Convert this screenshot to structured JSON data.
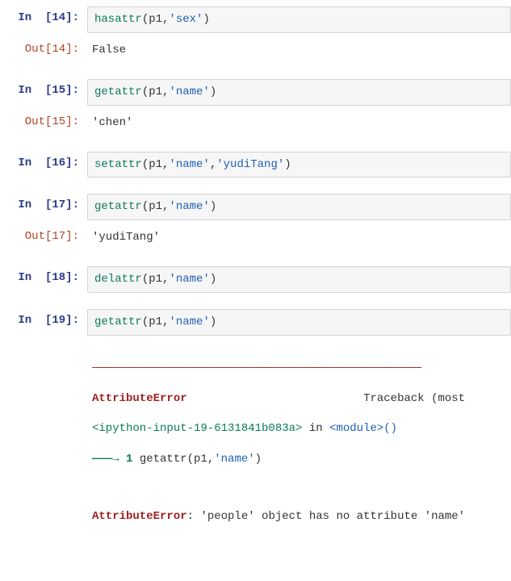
{
  "cells": [
    {
      "in_prompt": "In  [14]:",
      "code_fn": "hasattr",
      "code_args_pre": "(p1,",
      "code_str": "'sex'",
      "code_args_post": ")",
      "out_prompt": "Out[14]:",
      "out_text": "False"
    },
    {
      "in_prompt": "In  [15]:",
      "code_fn": "getattr",
      "code_args_pre": "(p1,",
      "code_str": "'name'",
      "code_args_post": ")",
      "out_prompt": "Out[15]:",
      "out_text": "'chen'"
    },
    {
      "in_prompt": "In  [16]:",
      "code_fn": "setattr",
      "code_args_pre": "(p1,",
      "code_str": "'name'",
      "code_mid": ",",
      "code_str2": "'yudiTang'",
      "code_args_post": ")"
    },
    {
      "in_prompt": "In  [17]:",
      "code_fn": "getattr",
      "code_args_pre": "(p1,",
      "code_str": "'name'",
      "code_args_post": ")",
      "out_prompt": "Out[17]:",
      "out_text": "'yudiTang'"
    },
    {
      "in_prompt": "In  [18]:",
      "code_fn": "delattr",
      "code_args_pre": "(p1,",
      "code_str": "'name'",
      "code_args_post": ")"
    },
    {
      "in_prompt": "In  [19]:",
      "code_fn": "getattr",
      "code_args_pre": "(p1,",
      "code_str": "'name'",
      "code_args_post": ")"
    }
  ],
  "traceback": {
    "divider": "———————————————————————————————————————————————————————",
    "err_name": "AttributeError",
    "tb_right": "Traceback (most",
    "src_ref": "<ipython-input-19-6131841b083a>",
    "in_word": " in ",
    "module_ref": "<module>",
    "parens": "()",
    "arrow": "———→ 1 ",
    "line_fn": "getattr",
    "line_pre": "(p1,",
    "line_str": "'name'",
    "line_post": ")",
    "final_err": "AttributeError",
    "final_msg": ": 'people' object has no attribute 'name'"
  }
}
